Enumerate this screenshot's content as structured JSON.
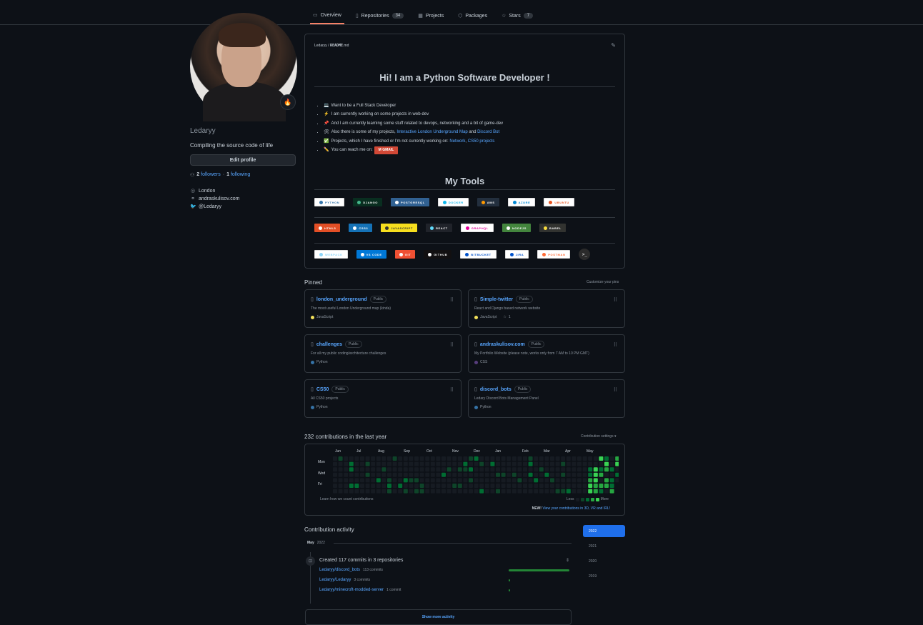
{
  "nav": {
    "tabs": [
      {
        "label": "Overview",
        "icon": "book-icon",
        "count": ""
      },
      {
        "label": "Repositories",
        "icon": "repo-icon",
        "count": "34"
      },
      {
        "label": "Projects",
        "icon": "project-icon",
        "count": ""
      },
      {
        "label": "Packages",
        "icon": "package-icon",
        "count": ""
      },
      {
        "label": "Stars",
        "icon": "star-icon",
        "count": "7"
      }
    ]
  },
  "profile": {
    "username": "Ledaryy",
    "bio": "Compiling the source code of life",
    "edit_label": "Edit profile",
    "followers_count": "2",
    "followers_label": "followers",
    "separator": "·",
    "following_count": "1",
    "following_label": "following",
    "location": "London",
    "website": "andraskulisov.com",
    "twitter": "@Ledaryy"
  },
  "readme": {
    "path_user": "Ledaryy",
    "path_sep": " / ",
    "path_file": "README",
    "path_ext": ".md",
    "title": "Hi! I am a Python Software Developer !",
    "bullets": [
      {
        "emoji": "💻",
        "text": "Want to be a Full Stack Developer"
      },
      {
        "emoji": "⚡",
        "text": "I am currently working on some projects in web-dev"
      },
      {
        "emoji": "📌",
        "text": "And I am currently learning some stuff related to devops, networking and a bit of game-dev"
      },
      {
        "emoji": "🛠",
        "pre": "Also there is some of my projects, ",
        "link1": "Interactive London Underground Map",
        "mid": " and ",
        "link2": "Discord Bot"
      },
      {
        "emoji": "✅",
        "pre": "Projects, which I have finished or I'm not currently working on: ",
        "link1": "Network",
        "mid": ", ",
        "link2": "CS50 projects"
      },
      {
        "emoji": "✏️",
        "text": "You can reach me on:",
        "badge": "GMAIL"
      }
    ],
    "tools_title": "My Tools",
    "badge_rows": [
      [
        {
          "label": "PYTHON",
          "bg": "#ffffff",
          "fg": "#3776ab",
          "dot": "#3776ab"
        },
        {
          "label": "DJANGO",
          "bg": "#092e20",
          "fg": "#ffffff",
          "dot": "#44b78b"
        },
        {
          "label": "POSTGRESQL",
          "bg": "#316192",
          "fg": "#ffffff",
          "dot": "#ffffff"
        },
        {
          "label": "DOCKER",
          "bg": "#ffffff",
          "fg": "#0db7ed",
          "dot": "#0db7ed"
        },
        {
          "label": "AWS",
          "bg": "#232f3e",
          "fg": "#ffffff",
          "dot": "#ff9900"
        },
        {
          "label": "AZURE",
          "bg": "#ffffff",
          "fg": "#0089d6",
          "dot": "#0089d6"
        },
        {
          "label": "UBUNTU",
          "bg": "#ffffff",
          "fg": "#e95420",
          "dot": "#e95420"
        }
      ],
      [
        {
          "label": "HTML5",
          "bg": "#e34f26",
          "fg": "#ffffff",
          "dot": "#ffffff"
        },
        {
          "label": "CSS3",
          "bg": "#1572b6",
          "fg": "#ffffff",
          "dot": "#ffffff"
        },
        {
          "label": "JAVASCRIPT",
          "bg": "#f7df1e",
          "fg": "#323330",
          "dot": "#323330"
        },
        {
          "label": "REACT",
          "bg": "#20232a",
          "fg": "#ffffff",
          "dot": "#61dafb"
        },
        {
          "label": "GRAPHQL",
          "bg": "#ffffff",
          "fg": "#e10098",
          "dot": "#e10098"
        },
        {
          "label": "NODEJS",
          "bg": "#43853d",
          "fg": "#ffffff",
          "dot": "#ffffff"
        },
        {
          "label": "BABEL",
          "bg": "#323330",
          "fg": "#ffffff",
          "dot": "#f9dc3e"
        }
      ],
      [
        {
          "label": "WEBPACK",
          "bg": "#ffffff",
          "fg": "#8dd6f9",
          "dot": "#8dd6f9"
        },
        {
          "label": "VS CODE",
          "bg": "#0078d7",
          "fg": "#ffffff",
          "dot": "#ffffff"
        },
        {
          "label": "GIT",
          "bg": "#f05033",
          "fg": "#ffffff",
          "dot": "#ffffff"
        },
        {
          "label": "GITHUB",
          "bg": "#121011",
          "fg": "#ffffff",
          "dot": "#ffffff"
        },
        {
          "label": "BITBUCKET",
          "bg": "#ffffff",
          "fg": "#0052cc",
          "dot": "#0052cc"
        },
        {
          "label": "JIRA",
          "bg": "#ffffff",
          "fg": "#0052cc",
          "dot": "#0052cc"
        },
        {
          "label": "POSTMAN",
          "bg": "#ffffff",
          "fg": "#ff6c37",
          "dot": "#ff6c37"
        }
      ]
    ],
    "terminal_glyph": ">_"
  },
  "pinned": {
    "title": "Pinned",
    "customize": "Customize your pins",
    "items": [
      {
        "name": "london_underground",
        "visibility": "Public",
        "desc": "The most useful London Underground map (kinda)",
        "lang": "JavaScript",
        "lang_color": "#f1e05a",
        "stars": ""
      },
      {
        "name": "Simple-twitter",
        "visibility": "Public",
        "desc": "React and Django based network website",
        "lang": "JavaScript",
        "lang_color": "#f1e05a",
        "stars": "1"
      },
      {
        "name": "challenges",
        "visibility": "Public",
        "desc": "For all my public coding/architecture challenges",
        "lang": "Python",
        "lang_color": "#3572a5",
        "stars": ""
      },
      {
        "name": "andraskulisov.com",
        "visibility": "Public",
        "desc": "My Portfolio Website (please note, works only from 7 AM to 10 PM GMT)",
        "lang": "CSS",
        "lang_color": "#563d7c",
        "stars": ""
      },
      {
        "name": "CS50",
        "visibility": "Public",
        "desc": "All CS50 projects",
        "lang": "Python",
        "lang_color": "#3572a5",
        "stars": ""
      },
      {
        "name": "discord_bots",
        "visibility": "Public",
        "desc": "Ledary Discord Bots Management Panel",
        "lang": "Python",
        "lang_color": "#3572a5",
        "stars": ""
      }
    ]
  },
  "contributions": {
    "title": "232 contributions in the last year",
    "settings": "Contribution settings ▾",
    "months": [
      "Jun",
      "Jul",
      "Aug",
      "Sep",
      "Oct",
      "Nov",
      "Dec",
      "Jan",
      "Feb",
      "Mar",
      "Apr",
      "May"
    ],
    "days": [
      "Mon",
      "Wed",
      "Fri"
    ],
    "learn": "Learn how we count contributions",
    "less": "Less",
    "more": "More",
    "new_tag": "NEW!",
    "new_link": "View your contributions in 3D, VR and IRL!",
    "colors": [
      "#161b22",
      "#0e4429",
      "#006d32",
      "#26a641",
      "#39d353"
    ]
  },
  "activity": {
    "title": "Contribution activity",
    "month": "May",
    "year": "2022",
    "summary": "Created 117 commits in 3 repositories",
    "repos": [
      {
        "name": "Ledaryy/discord_bots",
        "count": "113 commits",
        "share": 113
      },
      {
        "name": "Ledaryy/Ledaryy",
        "count": "3 commits",
        "share": 3
      },
      {
        "name": "Ledaryy/minecroft-modded-server",
        "count": "1 commit",
        "share": 1
      }
    ],
    "show_more": "Show more activity"
  },
  "years": [
    "2022",
    "2021",
    "2020",
    "2019"
  ]
}
